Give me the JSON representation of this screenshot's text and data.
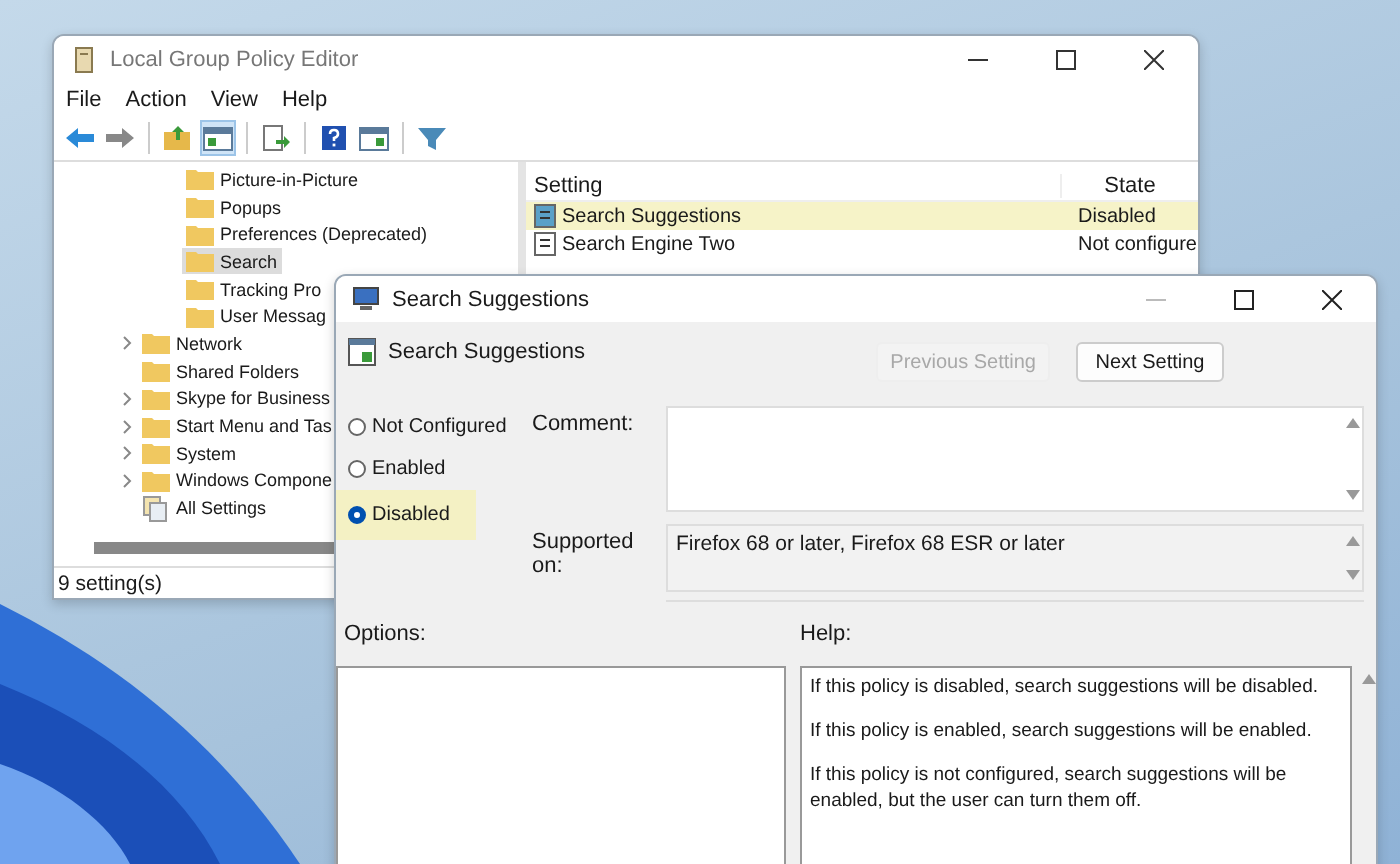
{
  "main_window": {
    "title": "Local Group Policy Editor",
    "menu": [
      "File",
      "Action",
      "View",
      "Help"
    ],
    "toolbar": [
      {
        "kind": "back",
        "selected": false
      },
      {
        "kind": "forward",
        "selected": false
      },
      {
        "kind": "up",
        "selected": false
      },
      {
        "kind": "tree",
        "selected": true
      },
      {
        "kind": "export",
        "selected": false
      },
      {
        "kind": "help",
        "selected": false
      },
      {
        "kind": "pane",
        "selected": false
      },
      {
        "kind": "filter",
        "selected": false
      }
    ],
    "tree": {
      "nested_items": [
        {
          "label": "Picture-in-Picture",
          "kind": "folder",
          "selected": false
        },
        {
          "label": "Popups",
          "kind": "folder",
          "selected": false
        },
        {
          "label": "Preferences (Deprecated)",
          "kind": "folder",
          "selected": false
        },
        {
          "label": "Search",
          "kind": "folder",
          "selected": true
        },
        {
          "label": "Tracking Pro",
          "kind": "folder",
          "selected": false
        },
        {
          "label": "User Messag",
          "kind": "folder",
          "selected": false
        }
      ],
      "items": [
        {
          "label": "Network",
          "kind": "folder",
          "selected": false,
          "expandable": true
        },
        {
          "label": "Shared Folders",
          "kind": "folder",
          "selected": false,
          "expandable": false
        },
        {
          "label": "Skype for Business",
          "kind": "folder",
          "selected": false,
          "expandable": true
        },
        {
          "label": "Start Menu and Tas",
          "kind": "folder",
          "selected": false,
          "expandable": true
        },
        {
          "label": "System",
          "kind": "folder",
          "selected": false,
          "expandable": true
        },
        {
          "label": "Windows Compone",
          "kind": "folder",
          "selected": false,
          "expandable": true
        },
        {
          "label": "All Settings",
          "kind": "settings",
          "selected": false,
          "expandable": false
        }
      ]
    },
    "list": {
      "columns": [
        "Setting",
        "State"
      ],
      "rows": [
        {
          "setting": "Search Suggestions",
          "state": "Disabled",
          "selected": true
        },
        {
          "setting": "Search Engine Two",
          "state": "Not configure",
          "selected": false
        }
      ]
    },
    "status_bar": "9 setting(s)"
  },
  "dialog": {
    "title": "Search Suggestions",
    "policy_name": "Search Suggestions",
    "buttons": [
      {
        "label": "Previous Setting",
        "disabled": true
      },
      {
        "label": "Next Setting",
        "disabled": false
      }
    ],
    "options": [
      {
        "label": "Not Configured",
        "selected": false
      },
      {
        "label": "Enabled",
        "selected": false
      },
      {
        "label": "Disabled",
        "selected": true
      }
    ],
    "comment_label": "Comment:",
    "supported_label": "Supported on:",
    "supported_value": "Firefox 68 or later, Firefox 68 ESR or later",
    "options_label": "Options:",
    "help_label": "Help:",
    "help_paragraphs": [
      "If this policy is disabled, search suggestions will be disabled.",
      "If this policy is enabled, search suggestions will be enabled.",
      "If this policy is not configured, search suggestions will be enabled, but the user can turn them off."
    ]
  }
}
